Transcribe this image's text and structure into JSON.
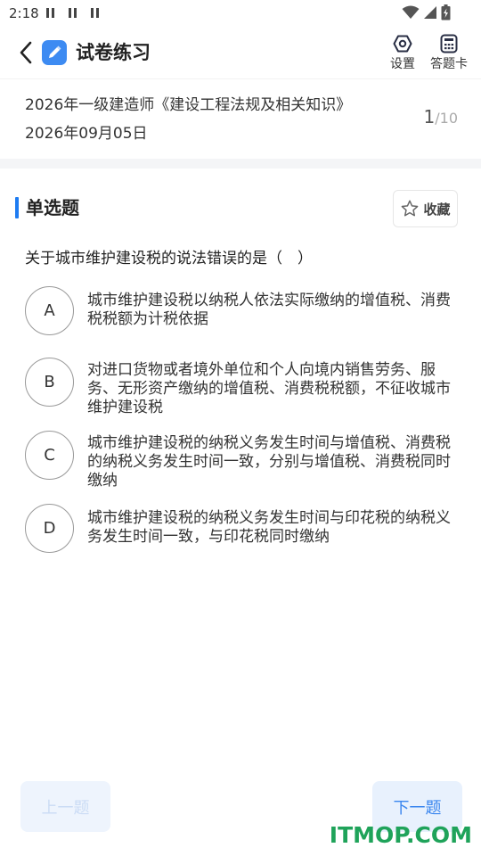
{
  "status_bar": {
    "time": "2:18",
    "notification_icons": [
      "pause-icon",
      "pause-icon",
      "pause-icon"
    ],
    "right_icons": [
      "wifi-icon",
      "signal-icon",
      "battery-charging-icon"
    ]
  },
  "app_bar": {
    "title": "试卷练习",
    "settings_label": "设置",
    "answer_card_label": "答题卡",
    "accent_color": "#3d8bf2"
  },
  "paper": {
    "name": "2026年一级建造师《建设工程法规及相关知识》",
    "date": "2026年09月05日",
    "current": "1",
    "total": "/10"
  },
  "question": {
    "type": "单选题",
    "favorite_label": "收藏",
    "stem": "关于城市维护建设税的说法错误的是（　）",
    "options": [
      {
        "letter": "A",
        "text": "城市维护建设税以纳税人依法实际缴纳的增值税、消费税税额为计税依据"
      },
      {
        "letter": "B",
        "text": "对进口货物或者境外单位和个人向境内销售劳务、服务、无形资产缴纳的增值税、消费税税额，不征收城市维护建设税"
      },
      {
        "letter": "C",
        "text": "城市维护建设税的纳税义务发生时间与增值税、消费税的纳税义务发生时间一致，分别与增值税、消费税同时缴纳"
      },
      {
        "letter": "D",
        "text": "城市维护建设税的纳税义务发生时间与印花税的纳税义务发生时间一致，与印花税同时缴纳"
      }
    ]
  },
  "footer": {
    "prev_label": "上一题",
    "next_label": "下一题",
    "prev_enabled": false
  },
  "watermark": "ITMOP.COM"
}
